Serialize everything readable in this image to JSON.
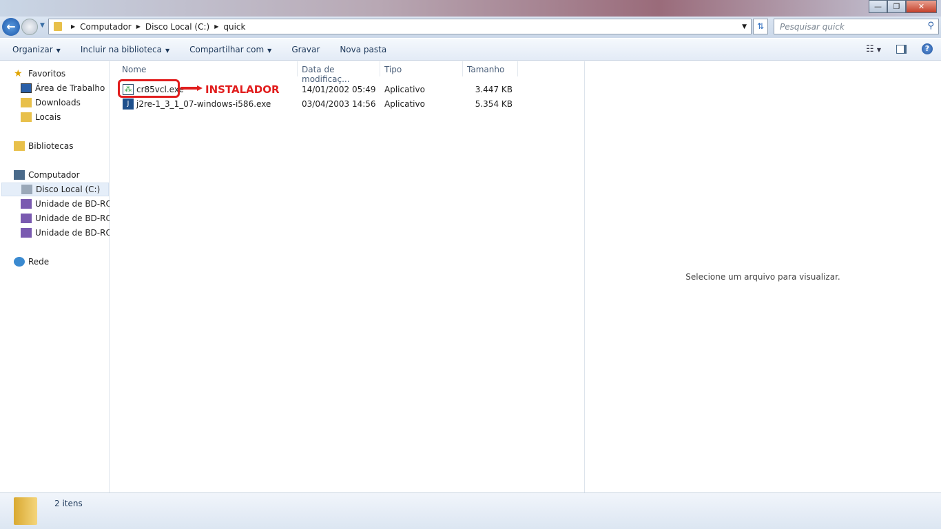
{
  "window": {
    "title": "",
    "minimize": "—",
    "maximize": "❐",
    "close": "✕"
  },
  "nav": {
    "back": "←",
    "breadcrumb": [
      "Computador",
      "Disco Local (C:)",
      "quick"
    ],
    "search_placeholder": "Pesquisar quick"
  },
  "toolbar": {
    "organize": "Organizar",
    "include_library": "Incluir na biblioteca",
    "share": "Compartilhar com",
    "burn": "Gravar",
    "new_folder": "Nova pasta",
    "help": "?"
  },
  "sidebar": {
    "favorites": "Favoritos",
    "desktop": "Área de Trabalho",
    "downloads": "Downloads",
    "recent": "Locais",
    "libraries": "Bibliotecas",
    "computer": "Computador",
    "local_disk": "Disco Local (C:)",
    "bd1": "Unidade de BD-ROM",
    "bd2": "Unidade de BD-ROM",
    "bd3": "Unidade de BD-ROM",
    "network": "Rede"
  },
  "columns": {
    "name": "Nome",
    "date": "Data de modificaç...",
    "type": "Tipo",
    "size": "Tamanho"
  },
  "files": [
    {
      "name": "cr85vcl.exe",
      "date": "14/01/2002 05:49",
      "type": "Aplicativo",
      "size": "3.447 KB"
    },
    {
      "name": "j2re-1_3_1_07-windows-i586.exe",
      "date": "03/04/2003 14:56",
      "type": "Aplicativo",
      "size": "5.354 KB"
    }
  ],
  "annotation": {
    "label": "INSTALADOR",
    "color": "#e11d1d"
  },
  "preview": {
    "message": "Selecione um arquivo para visualizar."
  },
  "status": {
    "count": "2 itens"
  }
}
